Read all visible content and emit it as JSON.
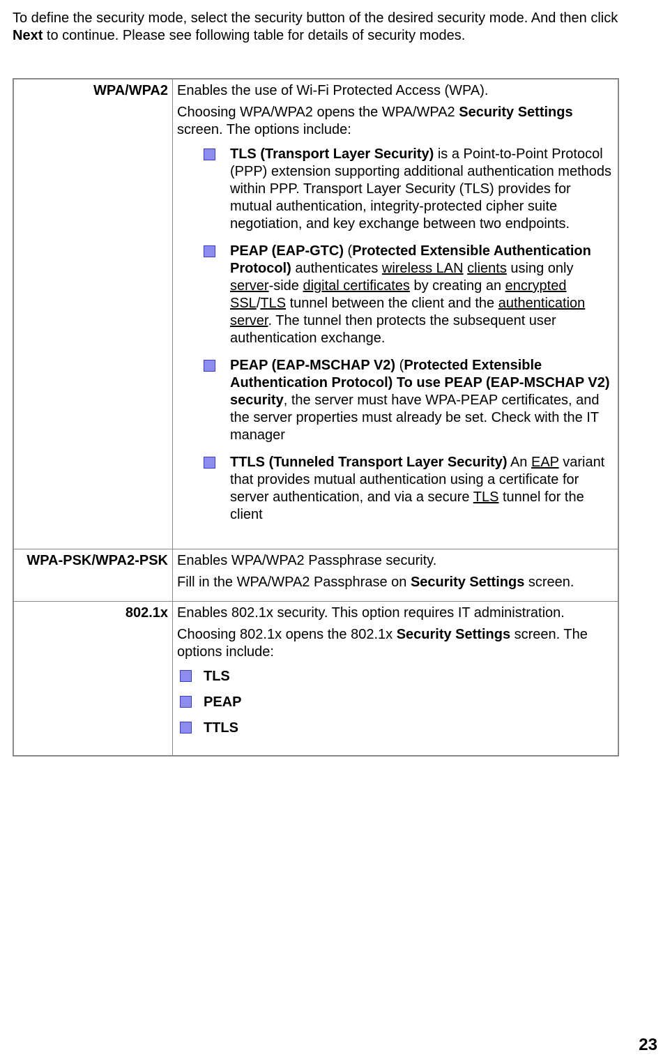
{
  "intro": {
    "prefix": "To define the security mode, select the security button of the desired security mode. And then click ",
    "bold": "Next",
    "suffix": " to continue. Please see following table for details of security modes."
  },
  "table": {
    "row1": {
      "label": "WPA/WPA2",
      "p1": "Enables the use of Wi-Fi Protected Access (WPA).",
      "p2_a": "Choosing WPA/WPA2 opens the WPA/WPA2 ",
      "p2_b": "Security Settings",
      "p2_c": " screen. The options include:",
      "b1_bold": "TLS (Transport Layer Security)",
      "b1_rest": " is a Point-to-Point Protocol (PPP) extension supporting additional authentication methods within PPP. Transport Layer Security (TLS) provides for mutual authentication, integrity-protected cipher suite negotiation, and key exchange between two endpoints.",
      "b2_bold1": "PEAP (EAP-GTC)",
      "b2_gap": "    (",
      "b2_bold2": "Protected Extensible Authentication Protocol)",
      "b2_t1": " authenticates ",
      "b2_u1": "wireless LAN",
      "b2_sp1": " ",
      "b2_u2": "clients",
      "b2_t2": " using only ",
      "b2_u3": "server",
      "b2_t3": "-side ",
      "b2_u4": "digital certificates",
      "b2_t4": " by creating an ",
      "b2_u5": "encrypted",
      "b2_sp2": " ",
      "b2_u6": "SSL",
      "b2_t5": "/",
      "b2_u7": "TLS",
      "b2_t6": " tunnel between the client and the ",
      "b2_u8": "authentication",
      "b2_sp3": " ",
      "b2_u9": "server",
      "b2_t7": ". The tunnel then protects the subsequent user authentication exchange.",
      "b3_bold1": "PEAP (EAP-MSCHAP V2)",
      "b3_paren": " (",
      "b3_bold2": "Protected Extensible Authentication Protocol) To use PEAP (EAP-MSCHAP V2) security",
      "b3_rest": ", the server must have WPA-PEAP certificates, and the server properties must already be set. Check with the IT manager",
      "b4_bold1": "TTLS",
      "b4_gap": "    ",
      "b4_bold2": "(Tunneled Transport Layer Security)",
      "b4_t1": " An ",
      "b4_u1": "EAP",
      "b4_t2": " variant that provides mutual authentication using a certificate for server authentication, and via a secure ",
      "b4_u2": "TLS",
      "b4_t3": " tunnel for the client"
    },
    "row2": {
      "label": "WPA-PSK/WPA2-PSK",
      "p1": "Enables WPA/WPA2 Passphrase security.",
      "p2_a": "Fill in the WPA/WPA2 Passphrase on ",
      "p2_b": "Security Settings",
      "p2_c": " screen."
    },
    "row3": {
      "label": "802.1x",
      "p1": "Enables 802.1x security.   This option requires IT administration.",
      "p2_a": "Choosing 802.1x opens the 802.1x ",
      "p2_b": "Security Settings",
      "p2_c": " screen. The options include:",
      "opt1": "TLS",
      "opt2": "PEAP",
      "opt3": "TTLS"
    }
  },
  "pagenum": "23"
}
